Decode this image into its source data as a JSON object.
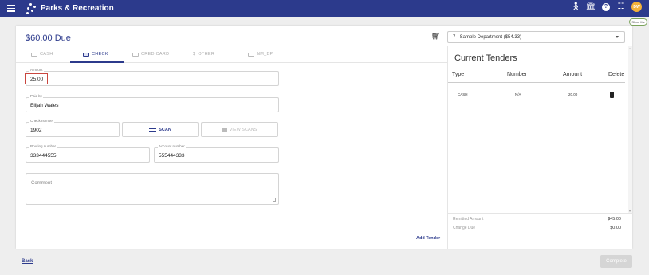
{
  "app": {
    "title": "Parks & Recreation",
    "user_initials": "DW",
    "show_me": "Show Me"
  },
  "header": {
    "due": "$60.00 Due",
    "department": "7 - Sample Department ($54.33)"
  },
  "tabs": [
    {
      "label": "CASH",
      "active": false
    },
    {
      "label": "CHECK",
      "active": true
    },
    {
      "label": "CRED CARD",
      "active": false
    },
    {
      "label": "OTHER",
      "active": false
    },
    {
      "label": "NM_BP",
      "active": false
    }
  ],
  "form": {
    "amount_label": "Amount",
    "amount": "25.00",
    "paid_by_label": "Paid by",
    "paid_by": "Elijah Wales",
    "check_number_label": "Check number",
    "check_number": "1902",
    "scan_label": "SCAN",
    "view_scans_label": "VIEW SCANS",
    "routing_label": "Routing number",
    "routing": "333444555",
    "account_label": "Account number",
    "account": "555444333",
    "comment_placeholder": "Comment",
    "add_tender": "Add Tender"
  },
  "tenders": {
    "title": "Current Tenders",
    "columns": [
      "Type",
      "Number",
      "Amount",
      "Delete"
    ],
    "rows": [
      {
        "type": "CASH",
        "number": "N/A",
        "amount": "20.00"
      }
    ],
    "remitted_label": "Remitted Amount",
    "remitted": "$45.00",
    "change_label": "Change Due",
    "change": "$0.00"
  },
  "footer": {
    "back": "Back",
    "complete": "Complete"
  },
  "colors": {
    "primary": "#2c3a8c",
    "avatar": "#f3b23a",
    "highlight": "#c9463f"
  },
  "icons": [
    "menu-icon",
    "parks-logo-icon",
    "figure-icon",
    "bank-icon",
    "help-icon",
    "apps-grid-icon",
    "cart-icon",
    "scan-icon",
    "view-scans-icon",
    "trash-icon"
  ]
}
